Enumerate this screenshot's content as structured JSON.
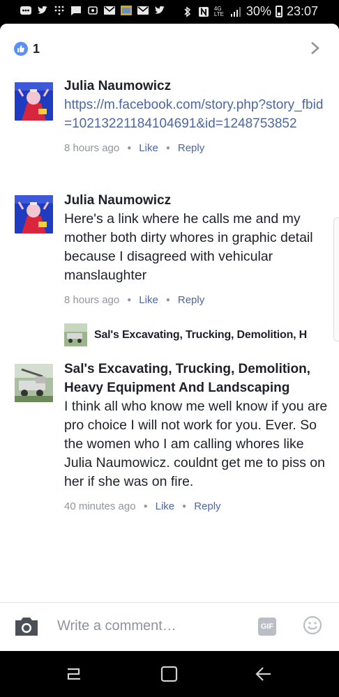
{
  "status_bar": {
    "network": "4G LTE",
    "battery": "30%",
    "time": "23:07",
    "icons": [
      "more-icon",
      "twitter-icon",
      "dialpad-icon",
      "message-icon",
      "notification-icon",
      "gmail-icon",
      "photo-icon",
      "gmail-icon",
      "twitter-icon",
      "bluetooth-icon",
      "nfc-icon",
      "signal-icon",
      "battery-icon"
    ]
  },
  "header": {
    "like_count": "1"
  },
  "comments": [
    {
      "author": "Julia Naumowicz",
      "link": "https://m.facebook.com/story.php?story_fbid=10213221184104691&id=1248753852",
      "time": "8 hours ago",
      "like": "Like",
      "reply": "Reply"
    },
    {
      "author": "Julia Naumowicz",
      "text": "Here's a link where he calls me and my mother both dirty whores in graphic detail because I disagreed with vehicular manslaughter",
      "time": "8 hours ago",
      "like": "Like",
      "reply": "Reply"
    },
    {
      "author": "Sal's Excavating, Trucking, Demolition, Heavy Equipment And Landscaping",
      "text": "I think all who know me well know if you are pro choice I will not work for you. Ever. So the women who I am calling whores like Julia Naumowicz. couldnt get me to piss on her if she was on fire.",
      "time": "40 minutes ago",
      "like": "Like",
      "reply": "Reply"
    }
  ],
  "reply_preview": {
    "author": "Sal's Excavating, Trucking, Demolition, H"
  },
  "composer": {
    "placeholder": "Write a comment…",
    "gif_label": "GIF"
  },
  "colors": {
    "link": "#4b67a1",
    "like_badge": "#5890ff",
    "meta": "#90949c"
  }
}
